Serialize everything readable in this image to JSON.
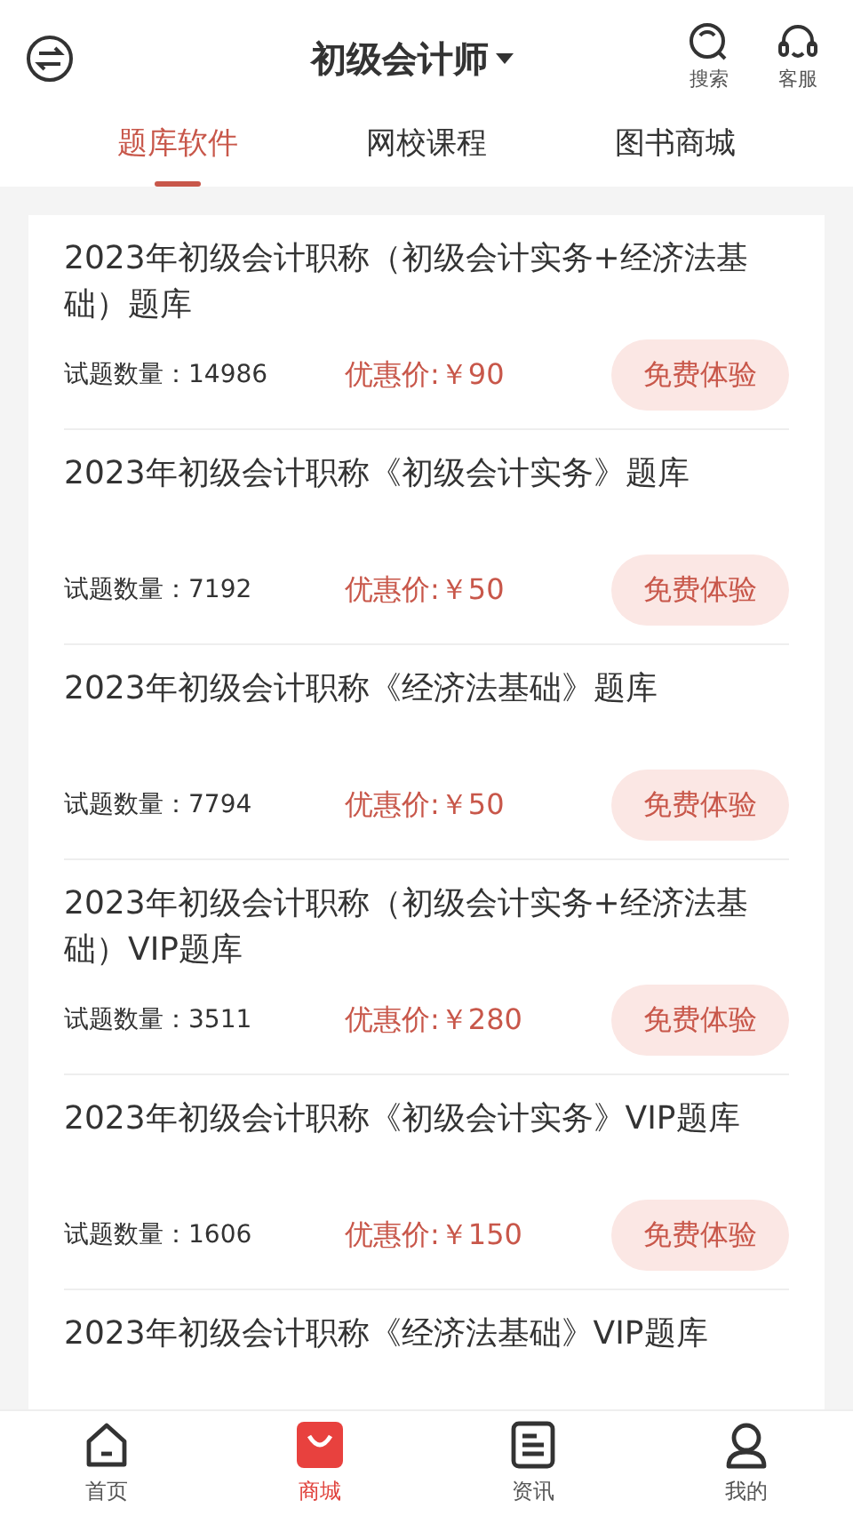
{
  "header": {
    "title": "初级会计师",
    "actions": [
      {
        "label": "搜索",
        "kind": "search"
      },
      {
        "label": "客服",
        "kind": "service"
      }
    ]
  },
  "tabs": [
    {
      "label": "题库软件",
      "selected": true
    },
    {
      "label": "网校课程",
      "selected": false
    },
    {
      "label": "图书商城",
      "selected": false
    }
  ],
  "items": [
    {
      "title": "2023年初级会计职称（初级会计实务+经济法基础）题库",
      "count": "试题数量：14986",
      "price": "优惠价:￥90",
      "button": "免费体验"
    },
    {
      "title": "2023年初级会计职称《初级会计实务》题库",
      "count": "试题数量：7192",
      "price": "优惠价:￥50",
      "button": "免费体验"
    },
    {
      "title": "2023年初级会计职称《经济法基础》题库",
      "count": "试题数量：7794",
      "price": "优惠价:￥50",
      "button": "免费体验"
    },
    {
      "title": "2023年初级会计职称（初级会计实务+经济法基础）VIP题库",
      "count": "试题数量：3511",
      "price": "优惠价:￥280",
      "button": "免费体验"
    },
    {
      "title": "2023年初级会计职称《初级会计实务》VIP题库",
      "count": "试题数量：1606",
      "price": "优惠价:￥150",
      "button": "免费体验"
    },
    {
      "title": "2023年初级会计职称《经济法基础》VIP题库"
    }
  ],
  "bottom_nav": [
    {
      "label": "首页",
      "kind": "home",
      "selected": false
    },
    {
      "label": "商城",
      "kind": "shop",
      "selected": true
    },
    {
      "label": "资讯",
      "kind": "news",
      "selected": false
    },
    {
      "label": "我的",
      "kind": "me",
      "selected": false
    }
  ]
}
